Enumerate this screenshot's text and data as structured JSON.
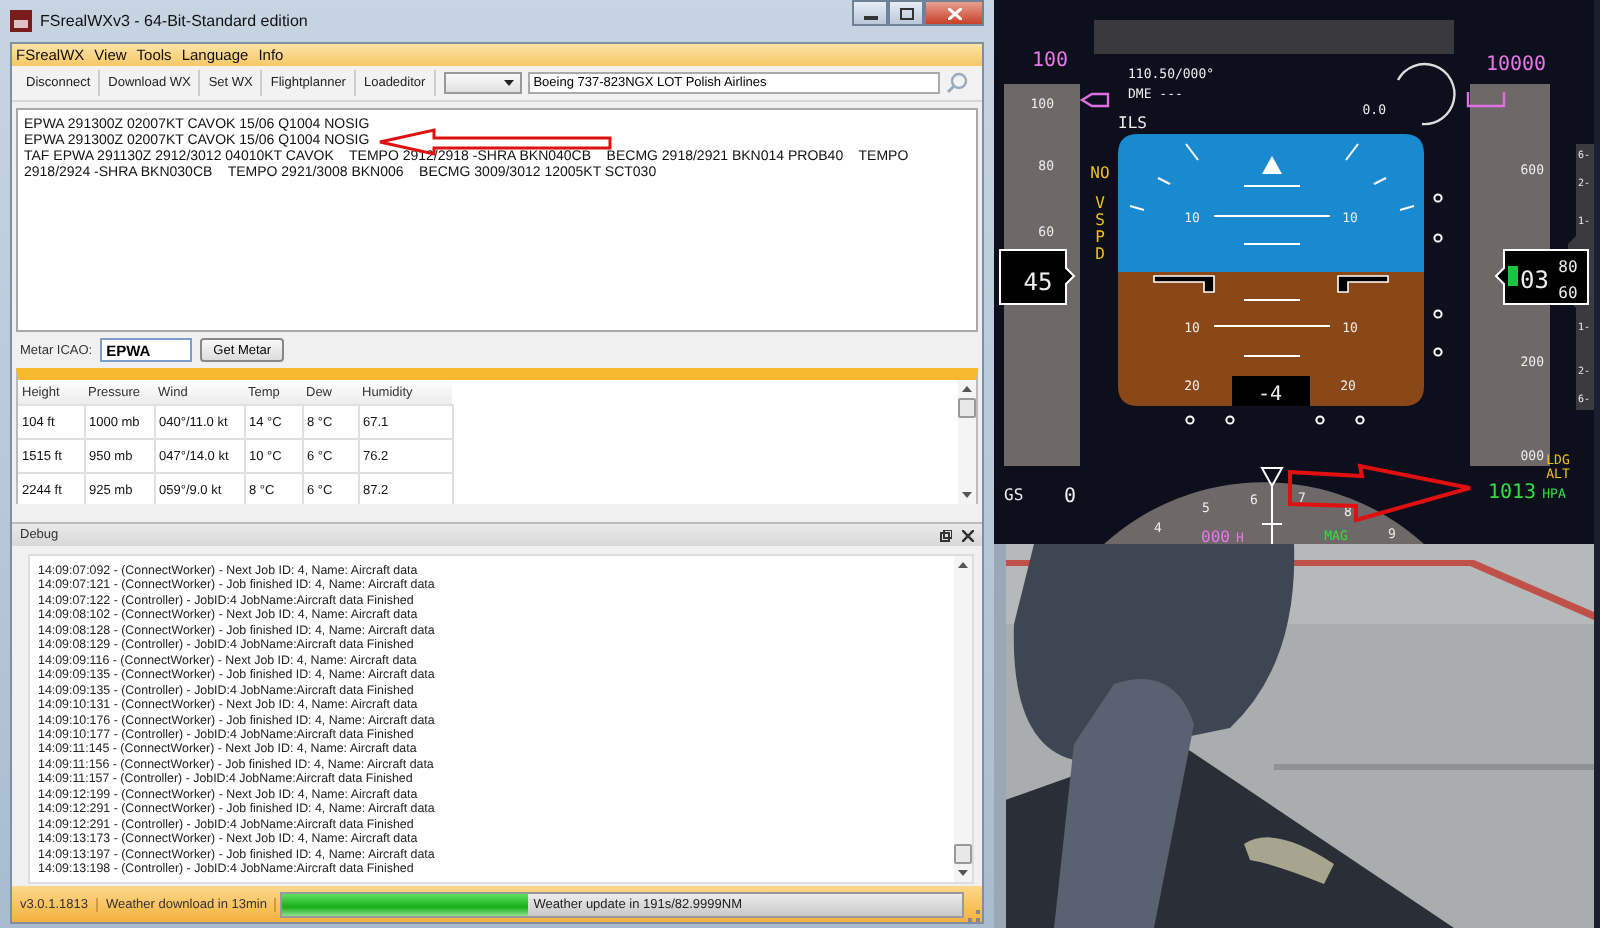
{
  "window": {
    "title": "FSrealWXv3 - 64-Bit-Standard edition"
  },
  "menu": [
    "FSrealWX",
    "View",
    "Tools",
    "Language",
    "Info"
  ],
  "toolbar": {
    "buttons": [
      "Disconnect",
      "Download WX",
      "Set WX",
      "Flightplanner",
      "Loadeditor"
    ],
    "aircraft": "Boeing 737-823NGX LOT Polish Airlines"
  },
  "weather_text": [
    "EPWA 291300Z 02007KT CAVOK 15/06 Q1004 NOSIG",
    "EPWA 291300Z 02007KT CAVOK 15/06 Q1004 NOSIG",
    "TAF EPWA 291130Z 2912/3012 04010KT CAVOK    TEMPO 2912/2918 -SHRA BKN040CB    BECMG 2918/2921 BKN014 PROB40    TEMPO 2918/2924 -SHRA BKN030CB    TEMPO 2921/3008 BKN006    BECMG 3009/3012 12005KT SCT030"
  ],
  "metar_lookup": {
    "label": "Metar ICAO:",
    "value": "EPWA",
    "button": "Get Metar"
  },
  "table": {
    "columns": [
      "Height",
      "Pressure",
      "Wind",
      "Temp",
      "Dew",
      "Humidity"
    ],
    "rows": [
      [
        "104 ft",
        "1000 mb",
        "040°/11.0 kt",
        "14 °C",
        "8 °C",
        "67.1"
      ],
      [
        "1515 ft",
        "950 mb",
        "047°/14.0 kt",
        "10 °C",
        "6 °C",
        "76.2"
      ],
      [
        "2244 ft",
        "925 mb",
        "059°/9.0 kt",
        "8 °C",
        "6 °C",
        "87.2"
      ]
    ]
  },
  "debug": {
    "title": "Debug",
    "lines": [
      "14:09:07:092 - (ConnectWorker) - Next Job ID: 4, Name: Aircraft data",
      "14:09:07:121 - (ConnectWorker) - Job finished ID: 4, Name: Aircraft data",
      "14:09:07:122 - (Controller) - JobID:4 JobName:Aircraft data  Finished",
      "14:09:08:102 - (ConnectWorker) - Next Job ID: 4, Name: Aircraft data",
      "14:09:08:128 - (ConnectWorker) - Job finished ID: 4, Name: Aircraft data",
      "14:09:08:129 - (Controller) - JobID:4 JobName:Aircraft data  Finished",
      "14:09:09:116 - (ConnectWorker) - Next Job ID: 4, Name: Aircraft data",
      "14:09:09:135 - (ConnectWorker) - Job finished ID: 4, Name: Aircraft data",
      "14:09:09:135 - (Controller) - JobID:4 JobName:Aircraft data  Finished",
      "14:09:10:131 - (ConnectWorker) - Next Job ID: 4, Name: Aircraft data",
      "14:09:10:176 - (ConnectWorker) - Job finished ID: 4, Name: Aircraft data",
      "14:09:10:177 - (Controller) - JobID:4 JobName:Aircraft data  Finished",
      "14:09:11:145 - (ConnectWorker) - Next Job ID: 4, Name: Aircraft data",
      "14:09:11:156 - (ConnectWorker) - Job finished ID: 4, Name: Aircraft data",
      "14:09:11:157 - (Controller) - JobID:4 JobName:Aircraft data  Finished",
      "14:09:12:199 - (ConnectWorker) - Next Job ID: 4, Name: Aircraft data",
      "14:09:12:291 - (ConnectWorker) - Job finished ID: 4, Name: Aircraft data",
      "14:09:12:291 - (Controller) - JobID:4 JobName:Aircraft data  Finished",
      "14:09:13:173 - (ConnectWorker) - Next Job ID: 4, Name: Aircraft data",
      "14:09:13:197 - (ConnectWorker) - Job finished ID: 4, Name: Aircraft data",
      "14:09:13:198 - (Controller) - JobID:4 JobName:Aircraft data  Finished"
    ]
  },
  "status_bar": {
    "version": "v3.0.1.1813",
    "download": "Weather download in 13min",
    "update": "Weather update in 191s/82.9999NM",
    "level": 0.36
  },
  "pfd": {
    "speed_bug": "100",
    "altitude_bug": "10000",
    "nav_freq": "110.50/000°",
    "dme": "DME ---",
    "approach": "ILS",
    "dial_value": "0.0",
    "no_flag": "NO",
    "vspd_flag": "VSPD",
    "speed_scale": [
      "100",
      "80",
      "60"
    ],
    "speed": "45",
    "pitch_labels": [
      "10",
      "10",
      "10",
      "10",
      "20",
      "20"
    ],
    "pitch_readout": "-4",
    "altitude_scale": [
      "600",
      "200",
      "000"
    ],
    "altitude": {
      "thousands": "03",
      "upper": "80",
      "lower": "60"
    },
    "vs_scale": [
      "6-",
      "2-",
      "1-",
      "1-",
      "2-",
      "6-"
    ],
    "ldg_alt": [
      "LDG",
      "ALT"
    ],
    "gs_label": "GS",
    "ground_speed": "0",
    "baro": "1013",
    "baro_unit": "HPA",
    "heading_scale": [
      "4",
      "5",
      "6",
      "7",
      "8",
      "9"
    ],
    "heading": "000",
    "heading_unit": "H",
    "heading_ref": "MAG"
  }
}
